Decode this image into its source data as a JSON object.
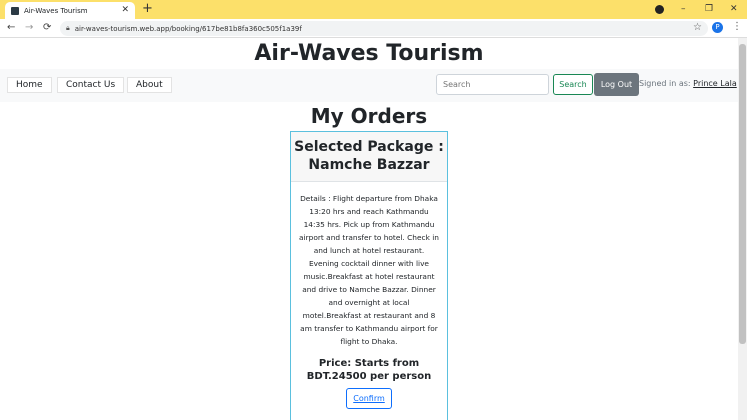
{
  "browser": {
    "tab_title": "Air-Waves Tourism",
    "tab_close": "✕",
    "new_tab": "+",
    "url": "air-waves-tourism.web.app/booking/617be81b8fa360c505f1a39f",
    "profile_initial": "P",
    "minimize": "–",
    "restore": "❐",
    "close": "✕"
  },
  "site": {
    "title": "Air-Waves Tourism"
  },
  "nav": {
    "links": [
      "Home",
      "Contact Us",
      "About"
    ],
    "search_placeholder": "Search",
    "search_button": "Search",
    "logout_button": "Log Out",
    "signed_in_prefix": "Signed in as:",
    "user_name": "Prince Lala"
  },
  "orders": {
    "heading": "My Orders",
    "card": {
      "header": "Selected Package : Namche Bazzar",
      "details": "Details : Flight departure from Dhaka 13:20 hrs and reach Kathmandu 14:35 hrs. Pick up from Kathmandu airport and transfer to hotel. Check in and lunch at hotel restaurant. Evening cocktail dinner with live music.Breakfast at hotel restaurant and drive to Namche Bazzar. Dinner and overnight at local motel.Breakfast at restaurant and 8 am transfer to Kathmandu airport for flight to Dhaka.",
      "price": "Price: Starts from BDT.24500 per person",
      "confirm_button": "Confirm"
    }
  }
}
